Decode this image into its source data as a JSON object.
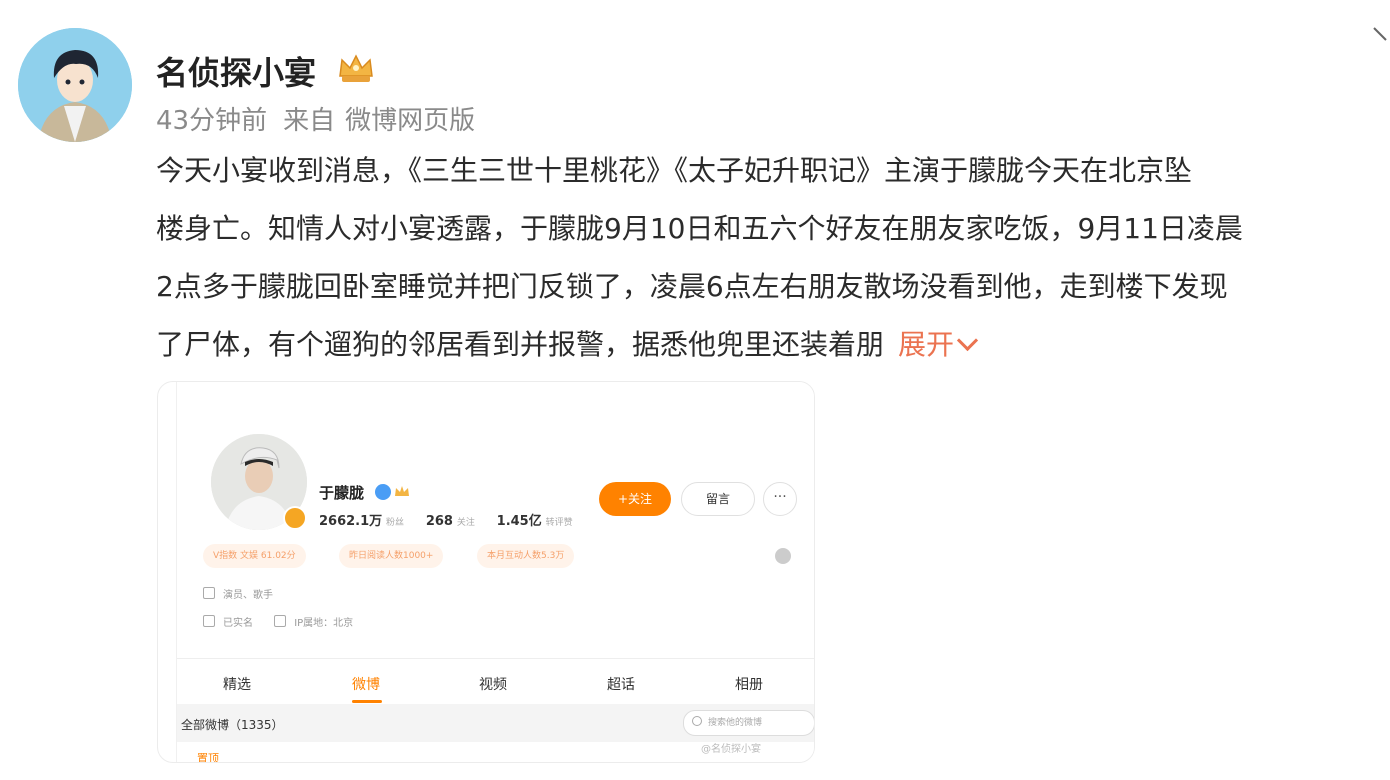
{
  "author": {
    "name": "名侦探小宴",
    "time": "43分钟前",
    "source_prefix": "来自",
    "source": "微博网页版"
  },
  "post": {
    "lines": [
      "今天小宴收到消息，《三生三世十里桃花》《太子妃升职记》主演于朦胧今天在北京坠",
      "楼身亡。知情人对小宴透露，于朦胧9月10日和五六个好友在朋友家吃饭，9月11日凌晨",
      "2点多于朦胧回卧室睡觉并把门反锁了，凌晨6点左右朋友散场没看到他，走到楼下发现",
      "了尸体，有个遛狗的邻居看到并报警，据悉他兜里还装着朋"
    ],
    "expand_label": "展开"
  },
  "embedded_profile": {
    "name": "于朦胧",
    "followers_count": "2662.1万",
    "followers_label": "粉丝",
    "following_count": "268",
    "following_label": "关注",
    "likes_count": "1.45亿",
    "likes_label": "转评赞",
    "follow_button": "+关注",
    "message_button": "留言",
    "more_button": "···",
    "tags": [
      "V指数 文娱 61.02分",
      "昨日阅读人数1000+",
      "本月互动人数5.3万"
    ],
    "occupation": "演员、歌手",
    "real_name": "已实名",
    "ip_location": "IP属地：北京",
    "tabs": [
      "精选",
      "微博",
      "视频",
      "超话",
      "相册"
    ],
    "active_tab": "微博",
    "filter_label": "全部微博（1335）",
    "search_placeholder": "搜索他的微博",
    "pinned_label": "置顶",
    "watermark": "@名侦探小宴"
  },
  "colors": {
    "accent_orange": "#eb7350",
    "weibo_orange": "#ff8200",
    "avatar_bg": "#8fd0ec"
  },
  "icons": [
    "crown-icon",
    "chevron-down-icon",
    "verified-icon",
    "more-icon",
    "search-icon"
  ]
}
